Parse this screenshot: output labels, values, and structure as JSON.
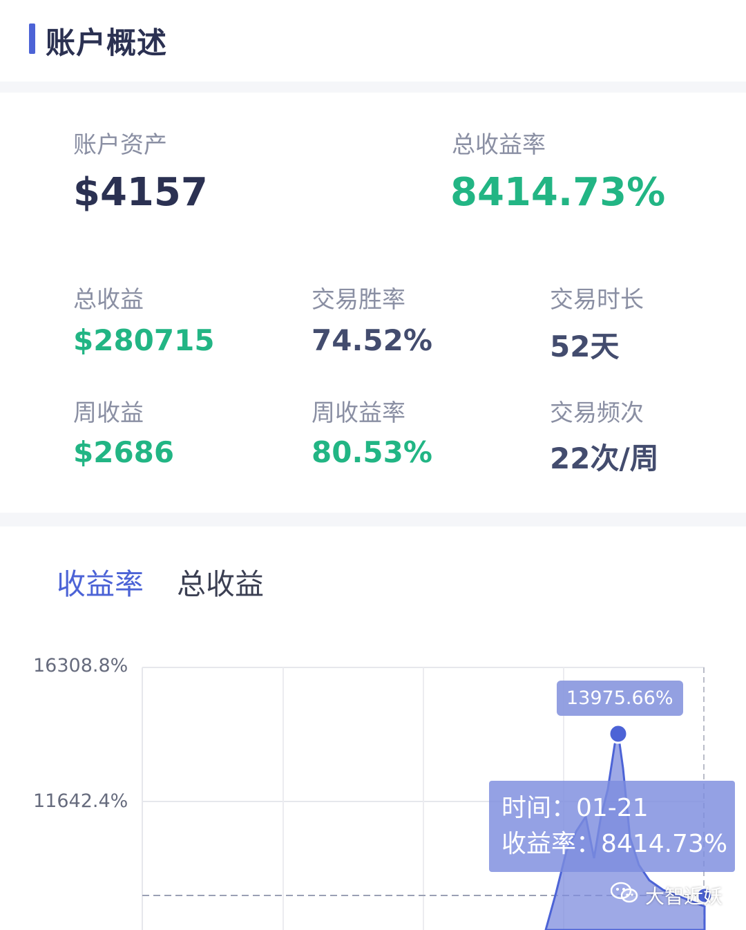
{
  "header": {
    "title": "账户概述"
  },
  "summary": {
    "assets": {
      "label": "账户资产",
      "value": "$4157"
    },
    "total_return_rate": {
      "label": "总收益率",
      "value": "8414.73%"
    }
  },
  "metrics": [
    {
      "label": "总收益",
      "value": "$280715"
    },
    {
      "label": "交易胜率",
      "value": "74.52%"
    },
    {
      "label": "交易时长",
      "value": "52天"
    },
    {
      "label": "周收益",
      "value": "$2686"
    },
    {
      "label": "周收益率",
      "value": "80.53%"
    },
    {
      "label": "交易频次",
      "value": "22次/周"
    }
  ],
  "tabs": [
    {
      "label": "收益率",
      "active": true
    },
    {
      "label": "总收益",
      "active": false
    }
  ],
  "chart_data": {
    "type": "area",
    "y_ticks": [
      "16308.8%",
      "11642.4%"
    ],
    "peak_label": "13975.66%",
    "tooltip": {
      "time_line": "时间：01-21",
      "rate_line": "收益率：8414.73%"
    },
    "colors": {
      "fill": "#7d8cde",
      "line": "#4c63d6",
      "grid": "#e6e7ec"
    }
  },
  "watermark": {
    "text": "大智近妖",
    "icon": "wechat-icon"
  }
}
